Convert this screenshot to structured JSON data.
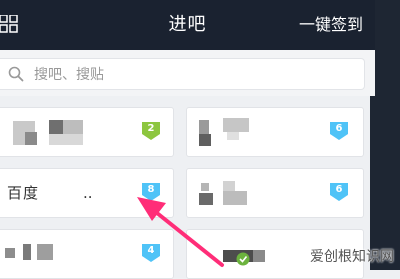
{
  "header": {
    "title": "进吧",
    "signin_label": "一键签到"
  },
  "search": {
    "placeholder": "搜吧、搜贴"
  },
  "tiles": [
    {
      "name": "",
      "badge": "2",
      "badge_color": "#8dc63f"
    },
    {
      "name": "",
      "badge": "6",
      "badge_color": "#4fc3f7"
    },
    {
      "name": "百度",
      "suffix": "..",
      "badge": "8",
      "badge_color": "#4fc3f7"
    },
    {
      "name": "",
      "badge": "6",
      "badge_color": "#4fc3f7"
    },
    {
      "name": "",
      "badge": "4",
      "badge_color": "#4fc3f7"
    },
    {
      "name": ""
    }
  ],
  "watermark": {
    "text": "爱创根知识网"
  },
  "colors": {
    "header_bg": "#1a2230",
    "arrow": "#ff2d78",
    "badge_green": "#8dc63f",
    "badge_blue": "#4fc3f7"
  }
}
